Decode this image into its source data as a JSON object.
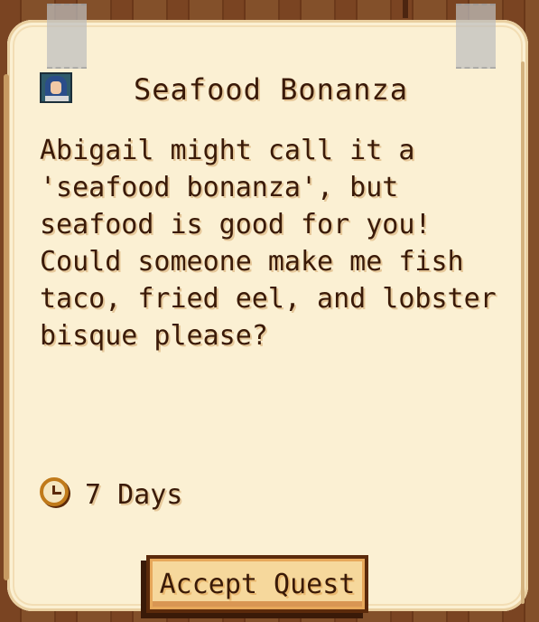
{
  "quest": {
    "title": "Seafood Bonanza",
    "description": "Abigail might call it a 'seafood bonanza', but seafood is good for you! Could someone make me fish taco, fried eel, and lobster bisque please?",
    "days_label": "7 Days",
    "accept_label": "Accept Quest"
  },
  "icons": {
    "portrait": "villager-portrait-icon",
    "clock": "clock-icon"
  },
  "colors": {
    "paper": "#fbf0d3",
    "text": "#3a1a08",
    "button": "#f6d89c",
    "wood": "#7a4422"
  }
}
